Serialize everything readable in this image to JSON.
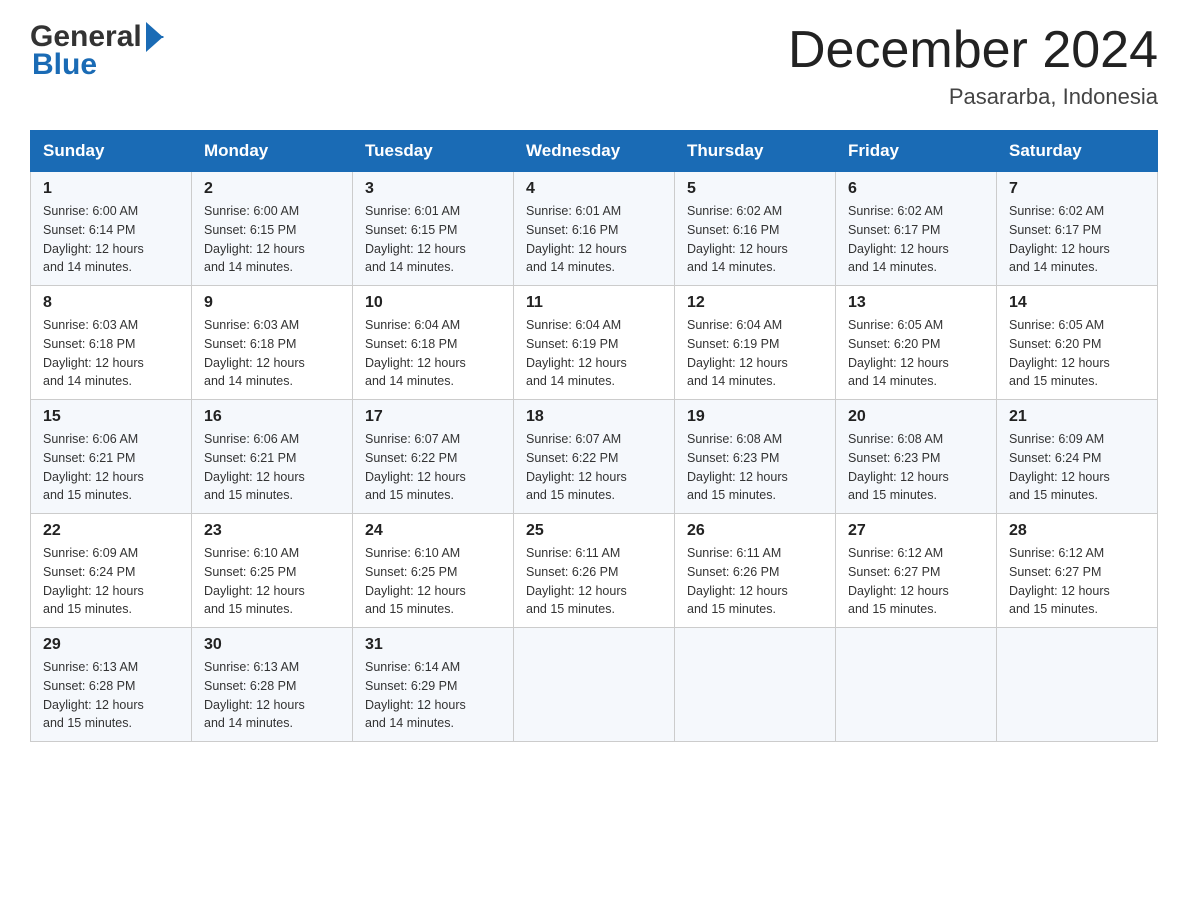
{
  "header": {
    "month_title": "December 2024",
    "location": "Pasararba, Indonesia",
    "logo_text_general": "General",
    "logo_text_blue": "Blue"
  },
  "days_of_week": [
    "Sunday",
    "Monday",
    "Tuesday",
    "Wednesday",
    "Thursday",
    "Friday",
    "Saturday"
  ],
  "weeks": [
    [
      {
        "day": "1",
        "sunrise": "6:00 AM",
        "sunset": "6:14 PM",
        "daylight": "12 hours and 14 minutes."
      },
      {
        "day": "2",
        "sunrise": "6:00 AM",
        "sunset": "6:15 PM",
        "daylight": "12 hours and 14 minutes."
      },
      {
        "day": "3",
        "sunrise": "6:01 AM",
        "sunset": "6:15 PM",
        "daylight": "12 hours and 14 minutes."
      },
      {
        "day": "4",
        "sunrise": "6:01 AM",
        "sunset": "6:16 PM",
        "daylight": "12 hours and 14 minutes."
      },
      {
        "day": "5",
        "sunrise": "6:02 AM",
        "sunset": "6:16 PM",
        "daylight": "12 hours and 14 minutes."
      },
      {
        "day": "6",
        "sunrise": "6:02 AM",
        "sunset": "6:17 PM",
        "daylight": "12 hours and 14 minutes."
      },
      {
        "day": "7",
        "sunrise": "6:02 AM",
        "sunset": "6:17 PM",
        "daylight": "12 hours and 14 minutes."
      }
    ],
    [
      {
        "day": "8",
        "sunrise": "6:03 AM",
        "sunset": "6:18 PM",
        "daylight": "12 hours and 14 minutes."
      },
      {
        "day": "9",
        "sunrise": "6:03 AM",
        "sunset": "6:18 PM",
        "daylight": "12 hours and 14 minutes."
      },
      {
        "day": "10",
        "sunrise": "6:04 AM",
        "sunset": "6:18 PM",
        "daylight": "12 hours and 14 minutes."
      },
      {
        "day": "11",
        "sunrise": "6:04 AM",
        "sunset": "6:19 PM",
        "daylight": "12 hours and 14 minutes."
      },
      {
        "day": "12",
        "sunrise": "6:04 AM",
        "sunset": "6:19 PM",
        "daylight": "12 hours and 14 minutes."
      },
      {
        "day": "13",
        "sunrise": "6:05 AM",
        "sunset": "6:20 PM",
        "daylight": "12 hours and 14 minutes."
      },
      {
        "day": "14",
        "sunrise": "6:05 AM",
        "sunset": "6:20 PM",
        "daylight": "12 hours and 15 minutes."
      }
    ],
    [
      {
        "day": "15",
        "sunrise": "6:06 AM",
        "sunset": "6:21 PM",
        "daylight": "12 hours and 15 minutes."
      },
      {
        "day": "16",
        "sunrise": "6:06 AM",
        "sunset": "6:21 PM",
        "daylight": "12 hours and 15 minutes."
      },
      {
        "day": "17",
        "sunrise": "6:07 AM",
        "sunset": "6:22 PM",
        "daylight": "12 hours and 15 minutes."
      },
      {
        "day": "18",
        "sunrise": "6:07 AM",
        "sunset": "6:22 PM",
        "daylight": "12 hours and 15 minutes."
      },
      {
        "day": "19",
        "sunrise": "6:08 AM",
        "sunset": "6:23 PM",
        "daylight": "12 hours and 15 minutes."
      },
      {
        "day": "20",
        "sunrise": "6:08 AM",
        "sunset": "6:23 PM",
        "daylight": "12 hours and 15 minutes."
      },
      {
        "day": "21",
        "sunrise": "6:09 AM",
        "sunset": "6:24 PM",
        "daylight": "12 hours and 15 minutes."
      }
    ],
    [
      {
        "day": "22",
        "sunrise": "6:09 AM",
        "sunset": "6:24 PM",
        "daylight": "12 hours and 15 minutes."
      },
      {
        "day": "23",
        "sunrise": "6:10 AM",
        "sunset": "6:25 PM",
        "daylight": "12 hours and 15 minutes."
      },
      {
        "day": "24",
        "sunrise": "6:10 AM",
        "sunset": "6:25 PM",
        "daylight": "12 hours and 15 minutes."
      },
      {
        "day": "25",
        "sunrise": "6:11 AM",
        "sunset": "6:26 PM",
        "daylight": "12 hours and 15 minutes."
      },
      {
        "day": "26",
        "sunrise": "6:11 AM",
        "sunset": "6:26 PM",
        "daylight": "12 hours and 15 minutes."
      },
      {
        "day": "27",
        "sunrise": "6:12 AM",
        "sunset": "6:27 PM",
        "daylight": "12 hours and 15 minutes."
      },
      {
        "day": "28",
        "sunrise": "6:12 AM",
        "sunset": "6:27 PM",
        "daylight": "12 hours and 15 minutes."
      }
    ],
    [
      {
        "day": "29",
        "sunrise": "6:13 AM",
        "sunset": "6:28 PM",
        "daylight": "12 hours and 15 minutes."
      },
      {
        "day": "30",
        "sunrise": "6:13 AM",
        "sunset": "6:28 PM",
        "daylight": "12 hours and 14 minutes."
      },
      {
        "day": "31",
        "sunrise": "6:14 AM",
        "sunset": "6:29 PM",
        "daylight": "12 hours and 14 minutes."
      },
      null,
      null,
      null,
      null
    ]
  ],
  "labels": {
    "sunrise": "Sunrise:",
    "sunset": "Sunset:",
    "daylight": "Daylight:"
  }
}
